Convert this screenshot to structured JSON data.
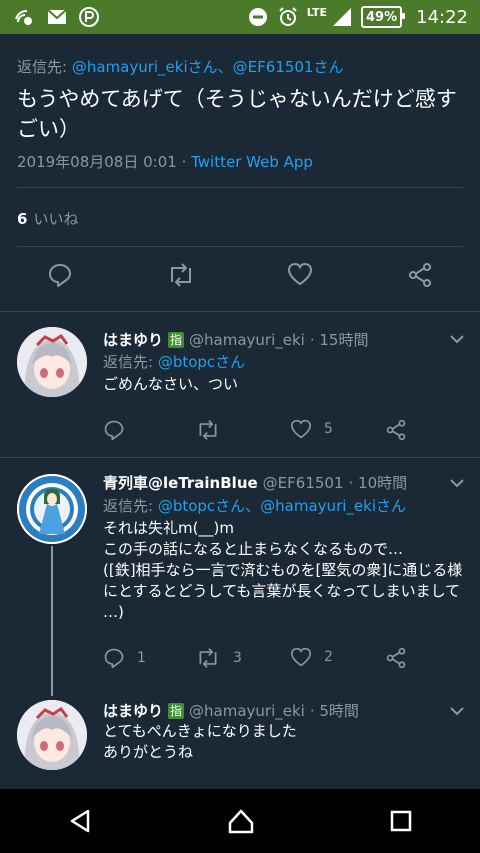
{
  "status_bar": {
    "battery": "49%",
    "network": "LTE",
    "time": "14:22"
  },
  "main_tweet": {
    "reply_to_prefix": "返信先: ",
    "reply_to_handles": "@hamayuri_ekiさん、@EF61501さん",
    "text": "もうやめてあげて（そうじゃないんだけど感すごい）",
    "timestamp": "2019年08月08日 0:01 · ",
    "client": "Twitter Web App",
    "like_count": "6",
    "like_label": "いいね"
  },
  "replies": [
    {
      "name": "はまゆり",
      "badge": "指",
      "handle": "@hamayuri_eki",
      "time": "· 15時間",
      "reply_to_prefix": "返信先: ",
      "reply_to_handles": "@btopcさん",
      "text": "ごめんなさい、つい",
      "reply_count": "",
      "retweet_count": "",
      "like_count": "5"
    },
    {
      "name": "青列車@leTrainBlue",
      "handle": "@EF61501",
      "time": "· 10時間",
      "reply_to_prefix": "返信先: ",
      "reply_to_handles": "@btopcさん、@hamayuri_ekiさん",
      "text_lines": [
        "それは失礼m(__)m",
        "この手の話になると止まらなくなるもので…",
        "([鉄]相手なら一言で済むものを[堅気の衆]に通じる様",
        "にとするとどうしても言葉が長くなってしまいまして",
        "…)"
      ],
      "reply_count": "1",
      "retweet_count": "3",
      "like_count": "2"
    },
    {
      "name": "はまゆり",
      "badge": "指",
      "handle": "@hamayuri_eki",
      "time": "· 5時間",
      "text_lines": [
        "とてもぺんきょになりました",
        "ありがとうね"
      ]
    }
  ],
  "colors": {
    "background": "#1b2836",
    "status_bar": "#4a7a2a",
    "accent_blue": "#1da1f2",
    "muted_text": "#8899a6",
    "divider": "#38444d"
  },
  "icons": {
    "reply": "reply-icon",
    "retweet": "retweet-icon",
    "like": "heart-icon",
    "share": "share-icon",
    "more": "chevron-down-icon",
    "nav_back": "back-triangle-icon",
    "nav_home": "home-circle-icon",
    "nav_recents": "recents-square-icon"
  }
}
